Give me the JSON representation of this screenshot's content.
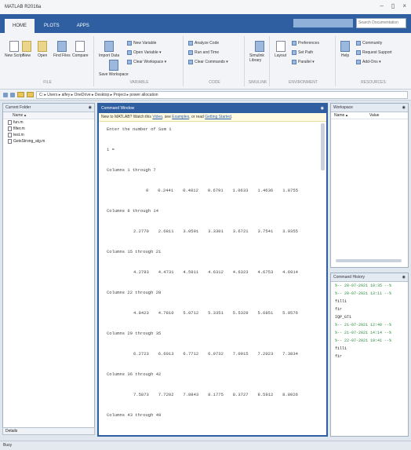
{
  "window": {
    "title": "MATLAB R2016a",
    "controls": [
      "–",
      "▯",
      "×"
    ]
  },
  "tabs": [
    {
      "label": "HOME",
      "active": true
    },
    {
      "label": "PLOTS",
      "active": false
    },
    {
      "label": "APPS",
      "active": false
    }
  ],
  "search": {
    "placeholder": "Search Documentation"
  },
  "ribbon": {
    "file": {
      "label": "FILE",
      "buttons": [
        "New Script",
        "New",
        "Open",
        "Find Files",
        "Compare"
      ]
    },
    "variable": {
      "label": "VARIABLE",
      "buttons": [
        "Import Data",
        "Save Workspace"
      ],
      "small": [
        "New Variable",
        "Open Variable ▾",
        "Clear Workspace ▾"
      ]
    },
    "code": {
      "label": "CODE",
      "small": [
        "Analyze Code",
        "Run and Time",
        "Clear Commands ▾"
      ]
    },
    "simulink": {
      "label": "SIMULINK",
      "buttons": [
        "Simulink Library"
      ]
    },
    "environment": {
      "label": "ENVIRONMENT",
      "buttons": [
        "Layout"
      ],
      "small": [
        "Preferences",
        "Set Path",
        "Parallel ▾"
      ]
    },
    "resources": {
      "label": "RESOURCES",
      "buttons": [
        "Help"
      ],
      "small": [
        "Community",
        "Request Support",
        "Add-Ons ▾"
      ]
    }
  },
  "address": {
    "path": "C: ▸ Users ▸ alfey ▸ OneDrive ▸ Desktop ▸ Project ▸ power allocation"
  },
  "current_folder": {
    "title": "Current Folder",
    "column": "Name ▴",
    "files": [
      "fun.m",
      "filter.m",
      "test.m",
      "GetsStrong_alg.m"
    ],
    "details": "Details"
  },
  "command_window": {
    "title": "Command Window",
    "banner_prefix": "New to MATLAB? Watch this ",
    "banner_link1": "Video",
    "banner_mid": ", see ",
    "banner_link2": "Examples",
    "banner_mid2": ", or read ",
    "banner_link3": "Getting Started",
    "banner_suffix": ".",
    "prompt_text": "Enter the number of Sum 1",
    "input_line": "1 =",
    "blocks": [
      {
        "header": "Columns 1 through 7",
        "values": [
          "0",
          "0.2441",
          "0.4812",
          "0.6791",
          "1.0633",
          "1.4636",
          "1.8755"
        ]
      },
      {
        "header": "Columns 8 through 14",
        "values": [
          "2.2770",
          "2.6811",
          "3.0591",
          "3.3301",
          "3.6721",
          "3.7541",
          "3.9355"
        ]
      },
      {
        "header": "Columns 15 through 21",
        "values": [
          "4.2783",
          "4.4731",
          "4.5911",
          "4.6312",
          "4.6323",
          "4.6753",
          "4.6914"
        ]
      },
      {
        "header": "Columns 22 through 28",
        "values": [
          "4.8423",
          "4.7810",
          "5.0712",
          "5.3351",
          "5.5329",
          "5.6851",
          "5.9576"
        ]
      },
      {
        "header": "Columns 29 through 35",
        "values": [
          "6.2723",
          "6.6013",
          "6.7712",
          "6.9732",
          "7.0915",
          "7.2023",
          "7.3834"
        ]
      },
      {
        "header": "Columns 36 through 42",
        "values": [
          "7.5873",
          "7.7202",
          "7.8843",
          "8.1775",
          "8.3727",
          "8.5912",
          "8.8026"
        ]
      }
    ],
    "last_header": "Columns 43 through 49"
  },
  "workspace": {
    "title": "Workspace",
    "col_name": "Name ▴",
    "col_value": "Value"
  },
  "command_history": {
    "title": "Command History",
    "items": [
      {
        "text": "%-- 20-07-2021 10:35 --%",
        "ts": true
      },
      {
        "text": "%-- 20-07-2021 13:11 --%",
        "ts": true
      },
      {
        "text": "fill1",
        "ts": false
      },
      {
        "text": "fir",
        "ts": false
      },
      {
        "text": "IQP_GT1",
        "ts": false
      },
      {
        "text": "%-- 21-07-2021 12:40 --%",
        "ts": true
      },
      {
        "text": "%-- 21-07-2021 14:14 --%",
        "ts": true
      },
      {
        "text": "%-- 22-07-2021 10:41 --%",
        "ts": true
      },
      {
        "text": "fill1",
        "ts": false
      },
      {
        "text": "fir",
        "ts": false
      }
    ]
  },
  "status": {
    "text": "Busy"
  }
}
